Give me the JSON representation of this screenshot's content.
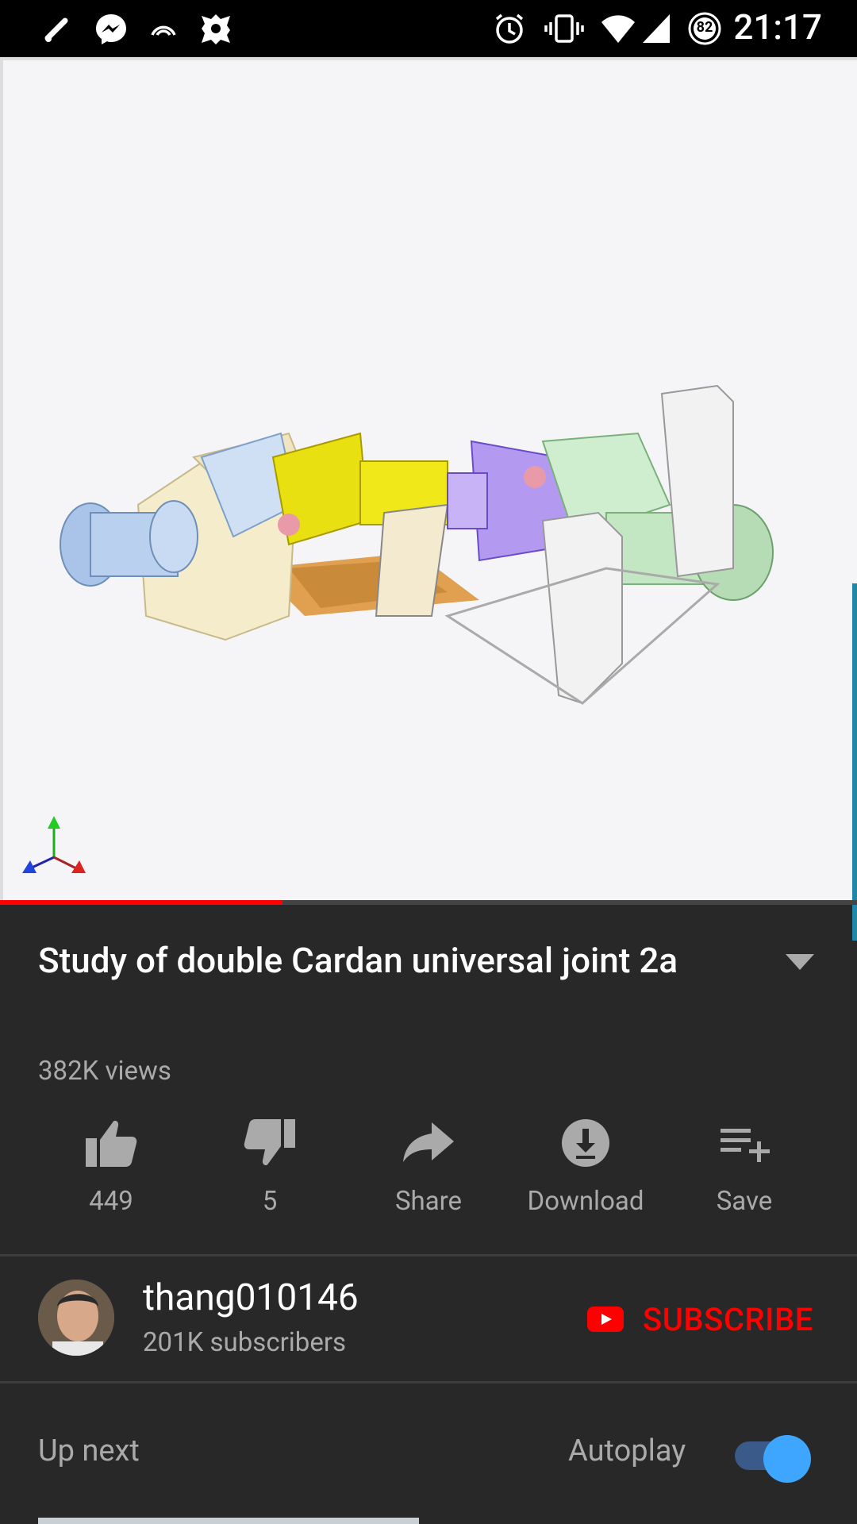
{
  "status_bar": {
    "time": "21:17",
    "battery": "82",
    "left_icons": [
      "edit-icon",
      "messenger-icon",
      "hotspot-icon",
      "app-icon"
    ],
    "right_icons": [
      "alarm-icon",
      "vibrate-icon",
      "wifi-icon",
      "signal-icon",
      "battery-icon"
    ]
  },
  "player": {
    "progress_fraction": 0.33,
    "progress_color": "#ff0000"
  },
  "video": {
    "title": "Study of double Cardan universal joint 2a",
    "views": "382K views"
  },
  "actions": [
    {
      "name": "like-button",
      "icon": "thumbs-up-icon",
      "label": "449"
    },
    {
      "name": "dislike-button",
      "icon": "thumbs-down-icon",
      "label": "5"
    },
    {
      "name": "share-button",
      "icon": "share-icon",
      "label": "Share"
    },
    {
      "name": "download-button",
      "icon": "download-icon",
      "label": "Download"
    },
    {
      "name": "save-button",
      "icon": "playlist-add-icon",
      "label": "Save"
    }
  ],
  "channel": {
    "name": "thang010146",
    "subscribers": "201K subscribers",
    "subscribe_label": "SUBSCRIBE",
    "subscribe_color": "#ff0000"
  },
  "up_next": {
    "label": "Up next",
    "autoplay_label": "Autoplay",
    "autoplay_on": true,
    "toggle_color": "#3ea6ff"
  }
}
